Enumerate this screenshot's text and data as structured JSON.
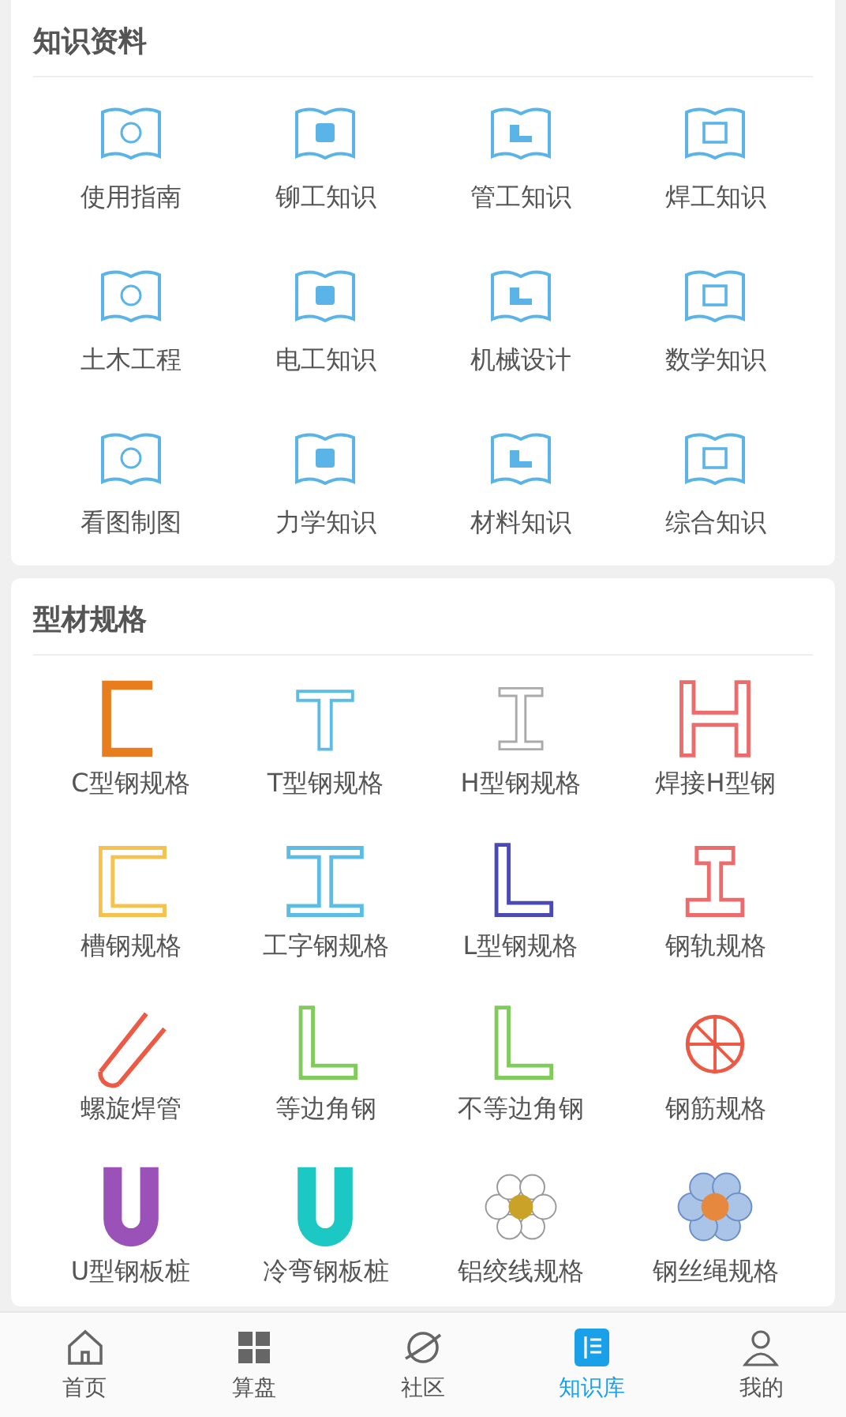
{
  "sections": [
    {
      "title": "知识资料",
      "kind": "books",
      "items": [
        {
          "label": "使用指南"
        },
        {
          "label": "铆工知识"
        },
        {
          "label": "管工知识"
        },
        {
          "label": "焊工知识"
        },
        {
          "label": "土木工程"
        },
        {
          "label": "电工知识"
        },
        {
          "label": "机械设计"
        },
        {
          "label": "数学知识"
        },
        {
          "label": "看图制图"
        },
        {
          "label": "力学知识"
        },
        {
          "label": "材料知识"
        },
        {
          "label": "综合知识"
        }
      ]
    },
    {
      "title": "型材规格",
      "kind": "profiles",
      "items": [
        {
          "label": "C型钢规格"
        },
        {
          "label": "T型钢规格"
        },
        {
          "label": "H型钢规格"
        },
        {
          "label": "焊接H型钢"
        },
        {
          "label": "槽钢规格"
        },
        {
          "label": "工字钢规格"
        },
        {
          "label": "L型钢规格"
        },
        {
          "label": "钢轨规格"
        },
        {
          "label": "螺旋焊管"
        },
        {
          "label": "等边角钢"
        },
        {
          "label": "不等边角钢"
        },
        {
          "label": "钢筋规格"
        },
        {
          "label": "U型钢板桩"
        },
        {
          "label": "冷弯钢板桩"
        },
        {
          "label": "铝绞线规格"
        },
        {
          "label": "钢丝绳规格"
        }
      ]
    }
  ],
  "nav": [
    {
      "label": "首页",
      "selected": false
    },
    {
      "label": "算盘",
      "selected": false
    },
    {
      "label": "社区",
      "selected": false
    },
    {
      "label": "知识库",
      "selected": true
    },
    {
      "label": "我的",
      "selected": false
    }
  ]
}
